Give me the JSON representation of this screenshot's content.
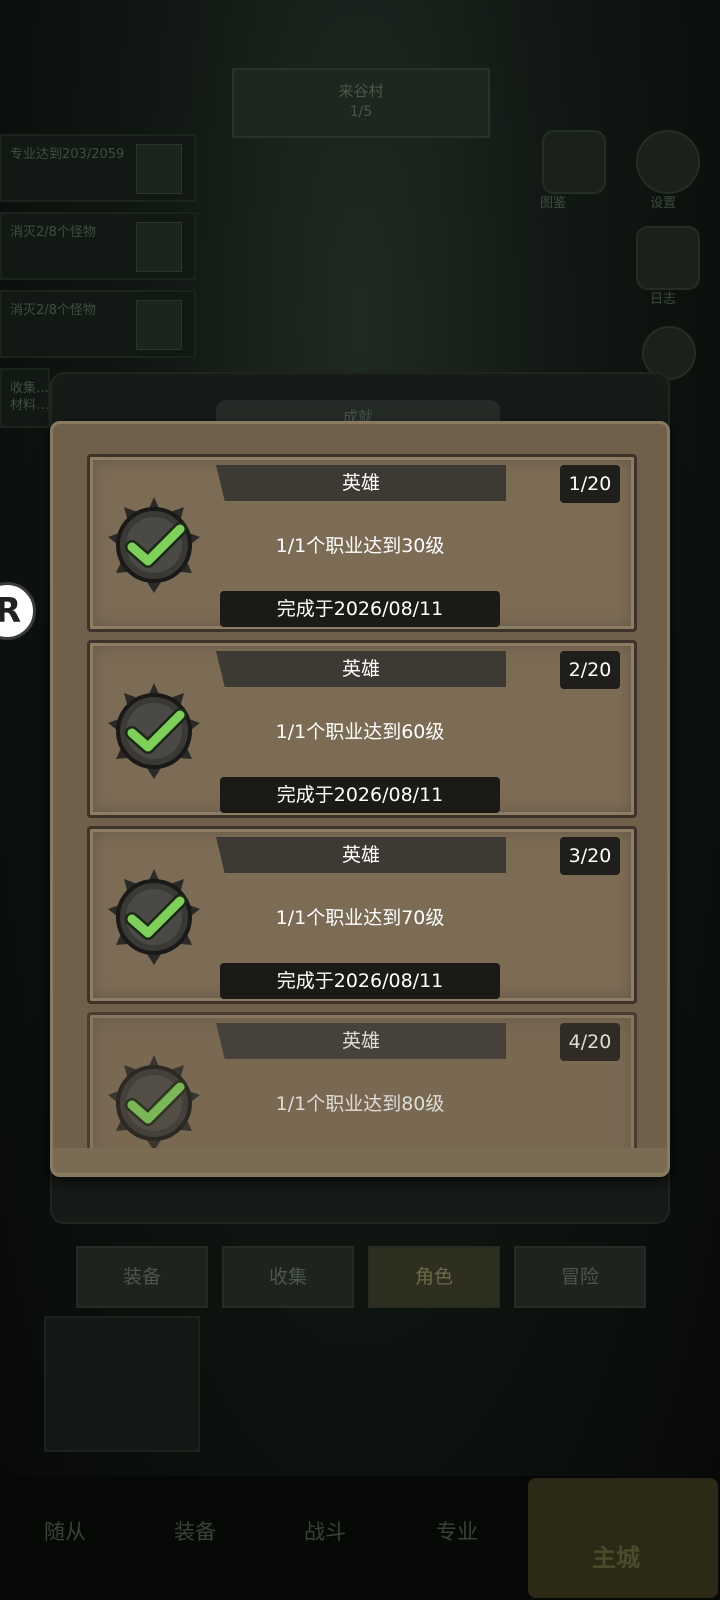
{
  "background": {
    "top_banner": {
      "line1": "来谷村",
      "line2": "1/5"
    },
    "quests": [
      {
        "text": "专业达到203/2059"
      },
      {
        "text": "消灭2/8个怪物"
      },
      {
        "text": "消灭2/8个怪物"
      },
      {
        "text": "收集…材料…"
      }
    ],
    "side_icons": [
      {
        "label": "图鉴",
        "icon": "book-icon"
      },
      {
        "label": "设置",
        "icon": "gear-icon"
      },
      {
        "label": "日志",
        "icon": "scroll-icon"
      },
      {
        "label": "",
        "icon": "coin-icon"
      }
    ],
    "panel_title": "成就",
    "tabs": [
      {
        "label": "装备",
        "selected": false
      },
      {
        "label": "收集",
        "selected": false
      },
      {
        "label": "角色",
        "selected": true
      },
      {
        "label": "冒险",
        "selected": false
      }
    ],
    "nav": [
      {
        "label": "随从"
      },
      {
        "label": "装备"
      },
      {
        "label": "战斗"
      },
      {
        "label": "专业"
      }
    ],
    "nav_home": "主城"
  },
  "achievements": [
    {
      "title": "英雄",
      "counter": "1/20",
      "description": "1/1个职业达到30级",
      "completed": "完成于2026/08/11"
    },
    {
      "title": "英雄",
      "counter": "2/20",
      "description": "1/1个职业达到60级",
      "completed": "完成于2026/08/11"
    },
    {
      "title": "英雄",
      "counter": "3/20",
      "description": "1/1个职业达到70级",
      "completed": "完成于2026/08/11"
    },
    {
      "title": "英雄",
      "counter": "4/20",
      "description": "1/1个职业达到80级",
      "completed": ""
    }
  ],
  "colors": {
    "check": "#7fd05a",
    "panel": "#6f604c",
    "card": "#7c6c56"
  }
}
